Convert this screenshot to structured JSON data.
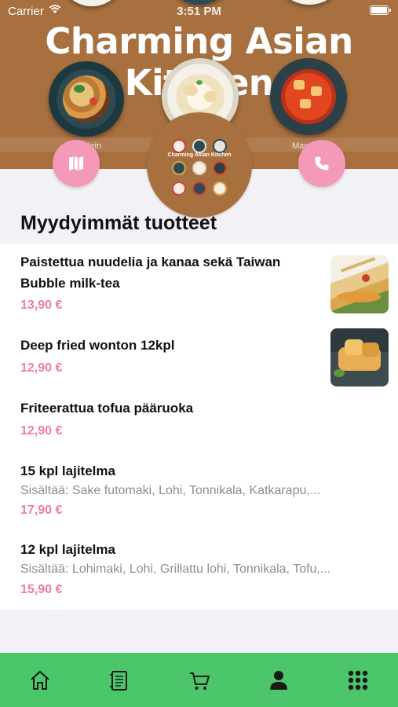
{
  "status_bar": {
    "carrier": "Carrier",
    "time": "3:51 PM"
  },
  "hero": {
    "title": "Charming Asian Kitchen",
    "caption_left": "lein",
    "caption_right": "Man"
  },
  "logo": {
    "title": "Charming Asian Kitchen"
  },
  "actions": {
    "map_icon": "map-icon",
    "phone_icon": "phone-icon"
  },
  "section": {
    "title": "Myydyimmät tuotteet"
  },
  "products": [
    {
      "name": "Paistettua nuudelia ja kanaa sekä Taiwan Bubble milk-tea",
      "description": "",
      "price": "13,90 €",
      "has_image": true
    },
    {
      "name": "Deep fried wonton 12kpl",
      "description": "",
      "price": "12,90 €",
      "has_image": true
    },
    {
      "name": "Friteerattua tofua pääruoka",
      "description": "",
      "price": "12,90 €",
      "has_image": false
    },
    {
      "name": "15 kpl lajitelma",
      "description": "Sisältää: Sake futomaki, Lohi, Tonnikala, Katkarapu,...",
      "price": "17,90 €",
      "has_image": false
    },
    {
      "name": "12 kpl lajitelma",
      "description": "Sisältää: Lohimaki, Lohi, Grillattu lohi, Tonnikala, Tofu,...",
      "price": "15,90 €",
      "has_image": false
    }
  ],
  "tabbar": {
    "background": "#4bc66a",
    "tabs": [
      "home-icon",
      "menu-icon",
      "cart-icon",
      "profile-icon",
      "grid-icon"
    ],
    "active": "profile-icon"
  },
  "colors": {
    "accent_pink": "#f49ab8",
    "price_pink": "#f07aa8",
    "hero_brown": "#a8703f"
  }
}
